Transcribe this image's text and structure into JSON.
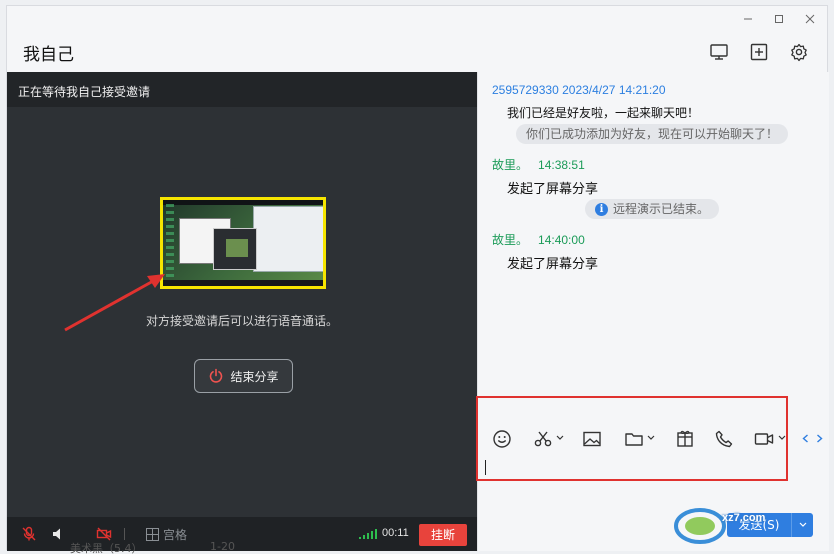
{
  "window": {
    "title": "我自己",
    "controls": [
      "minimize-icon",
      "maximize-icon",
      "close-icon"
    ],
    "toolbar_icons": [
      "screen-share-icon",
      "add-member-icon",
      "settings-icon"
    ]
  },
  "video": {
    "status": "正在等待我自己接受邀请",
    "invite_text": "对方接受邀请后可以进行语音通话。",
    "end_share_label": "结束分享",
    "grid_label": "宫格",
    "timer": "00:11",
    "hangup_label": "挂断",
    "colors": {
      "hangup": "#e8433c",
      "highlight": "#f6e500",
      "annotation": "#e0322f"
    }
  },
  "chat": {
    "messages": [
      {
        "name": "2595729330",
        "time": "2023/4/27 14:21:20",
        "text": "我们已经是好友啦，一起来聊天吧！"
      },
      {
        "system": "你们已成功添加为好友，现在可以开始聊天了！"
      },
      {
        "name": "故里。",
        "time": "14:38:51",
        "text": "发起了屏幕分享"
      },
      {
        "system": "远程演示已结束。"
      },
      {
        "name": "故里。",
        "time": "14:40:00",
        "text": "发起了屏幕分享"
      }
    ],
    "toolbar": [
      "emoji-icon",
      "scissors-icon",
      "image-icon",
      "folder-icon",
      "gift-icon",
      "phone-icon",
      "video-icon"
    ],
    "send_label": "发送(S)"
  },
  "background_list": {
    "name": "美术黑（5.4）",
    "time": "1-20"
  },
  "watermark": {
    "text": "xz7.com"
  }
}
